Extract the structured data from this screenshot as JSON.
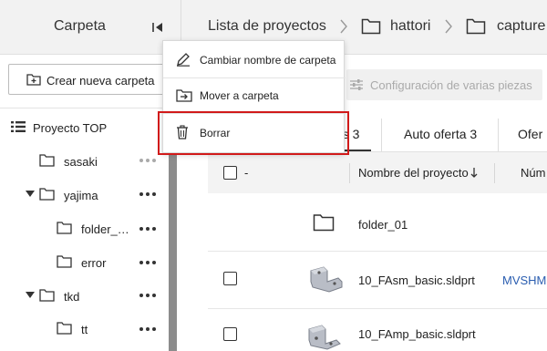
{
  "header": {
    "folder_title": "Carpeta",
    "breadcrumbs": [
      "Lista de proyectos",
      "hattori",
      "capture"
    ]
  },
  "sidebar": {
    "new_folder_label": "Crear nueva carpeta",
    "tree": {
      "root_label": "Proyecto TOP",
      "items": [
        {
          "label": "sasaki"
        },
        {
          "label": "yajima"
        },
        {
          "label": "folder_…"
        },
        {
          "label": "error"
        },
        {
          "label": "tkd"
        },
        {
          "label": "tt"
        }
      ]
    }
  },
  "toolbar": {
    "config_label": "Configuración de varias piezas"
  },
  "tabs": [
    {
      "label": "os 3"
    },
    {
      "label": "Auto oferta 3"
    },
    {
      "label": "Ofer"
    }
  ],
  "table": {
    "headers": [
      "-",
      "Nombre del proyecto",
      "Núm"
    ],
    "rows": [
      {
        "name": "folder_01",
        "num": ""
      },
      {
        "name": "10_FAsm_basic.sldprt",
        "num": "MVSHM"
      },
      {
        "name": "10_FAmp_basic.sldprt",
        "num": ""
      }
    ]
  },
  "context_menu": {
    "items": [
      {
        "label": "Cambiar nombre de carpeta"
      },
      {
        "label": "Mover a carpeta"
      },
      {
        "label": "Borrar"
      }
    ]
  },
  "colors": {
    "highlight": "#d11a1a",
    "link": "#2a5db0",
    "header_bg": "#f2f2f2"
  }
}
